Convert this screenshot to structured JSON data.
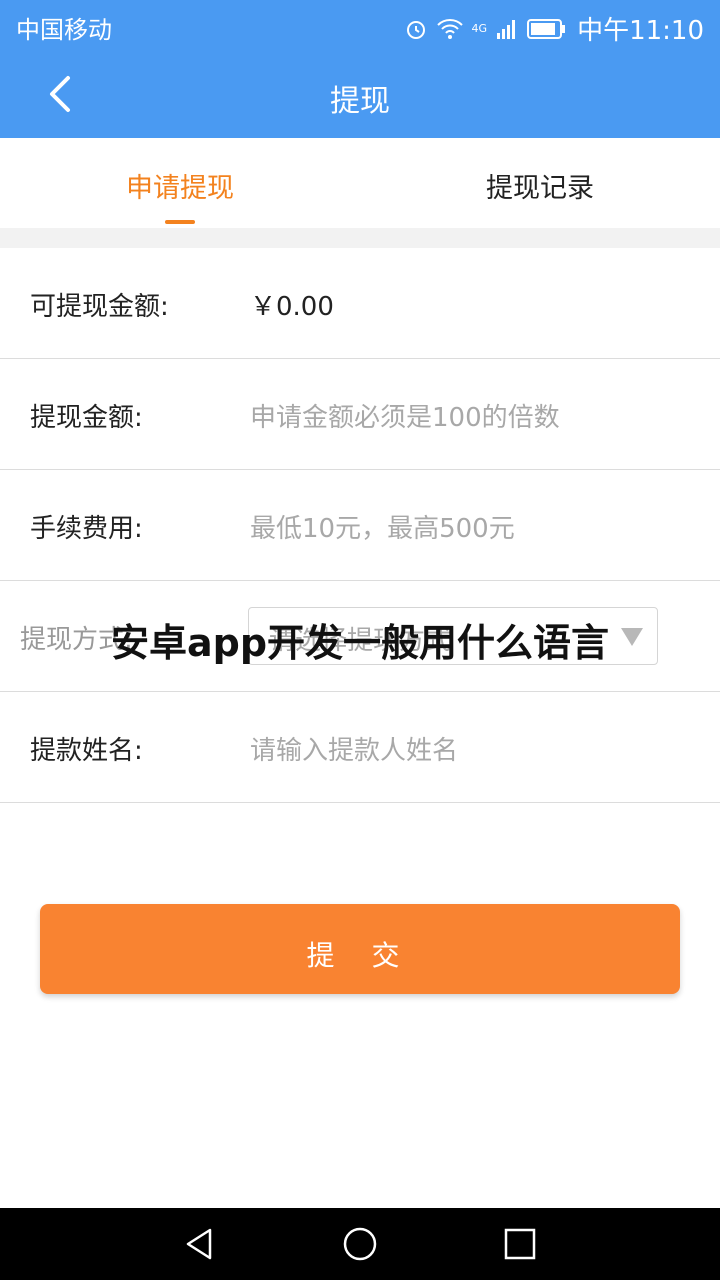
{
  "statusbar": {
    "carrier": "中国移动",
    "network": "4G",
    "time": "中午11:10",
    "icons": [
      "alarm-icon",
      "wifi-icon",
      "signal-icon",
      "battery-icon"
    ]
  },
  "appbar": {
    "title": "提现"
  },
  "tabs": [
    {
      "label": "申请提现",
      "active": true
    },
    {
      "label": "提现记录",
      "active": false
    }
  ],
  "form": {
    "available": {
      "label": "可提现金额:",
      "value": "￥0.00"
    },
    "amount": {
      "label": "提现金额:",
      "placeholder": "申请金额必须是100的倍数"
    },
    "fee": {
      "label": "手续费用:",
      "value": "最低10元，最高500元"
    },
    "method": {
      "label": "提现方式:",
      "placeholder": "请选择提现方式"
    },
    "name": {
      "label": "提款姓名:",
      "placeholder": "请输入提款人姓名"
    }
  },
  "overlay_text": "安卓app开发一般用什么语言",
  "submit_label": "提 交",
  "colors": {
    "primary": "#4a9af2",
    "accent": "#f3821e",
    "button": "#f98331"
  }
}
